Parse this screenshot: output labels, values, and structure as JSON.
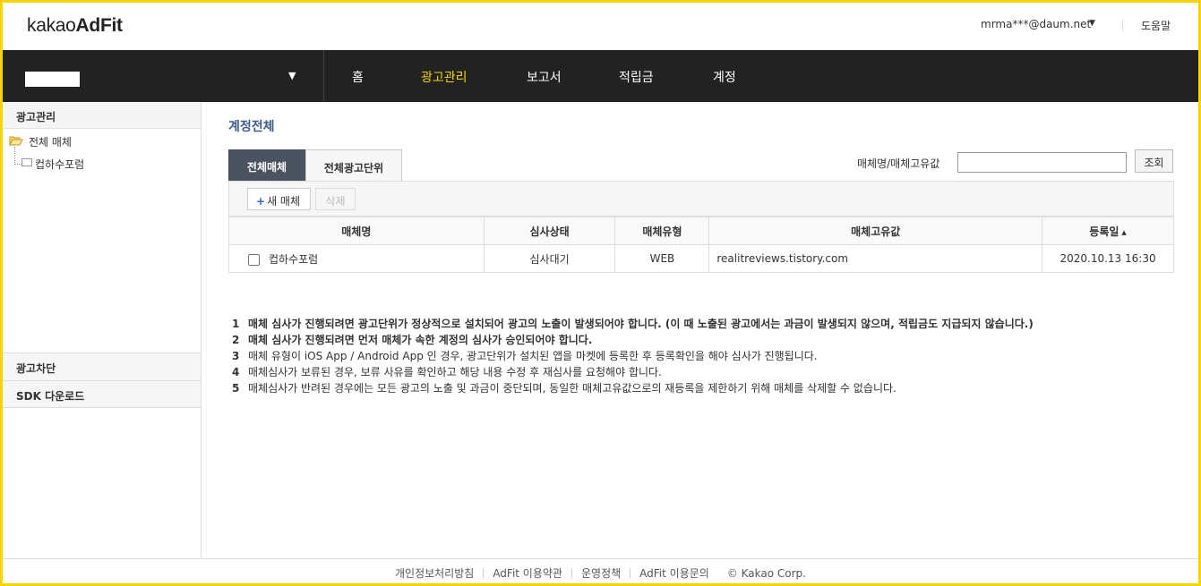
{
  "header": {
    "logo_light": "kakao",
    "logo_bold": "AdFit",
    "user_email": "mrma***@daum.net",
    "help": "도움말"
  },
  "nav": {
    "items": [
      {
        "label": "홈"
      },
      {
        "label": "광고관리"
      },
      {
        "label": "보고서"
      },
      {
        "label": "적립금"
      },
      {
        "label": "계정"
      }
    ],
    "active_index": 1,
    "active_color": "#f5d400"
  },
  "sidebar": {
    "section_title": "광고관리",
    "tree": {
      "root": "전체 매체",
      "children": [
        "컵하수포럼"
      ]
    },
    "menus": [
      "광고차단",
      "SDK 다운로드"
    ]
  },
  "main": {
    "page_title": "계정전체",
    "tabs": [
      {
        "label": "전체매체",
        "active": true
      },
      {
        "label": "전체광고단위",
        "active": false
      }
    ],
    "search": {
      "label": "매체명/매체고유값",
      "value": "",
      "button": "조회"
    },
    "toolbar": {
      "new_button": "새 매체",
      "delete_button": "삭제"
    },
    "table": {
      "columns": [
        "매체명",
        "심사상태",
        "매체유형",
        "매체고유값",
        "등록일"
      ],
      "rows": [
        [
          "컵하수포럼",
          "심사대기",
          "WEB",
          "realitreviews.tistory.com",
          "2020.10.13 16:30"
        ]
      ]
    },
    "notes": [
      {
        "num": "1",
        "text": "매체 심사가 진행되려면 광고단위가 정상적으로 설치되어 광고의 노출이 발생되어야 합니다. (이 때 노출된 광고에서는 과금이 발생되지 않으며, 적립금도 지급되지 않습니다.)",
        "bold": true
      },
      {
        "num": "2",
        "text": "매체 심사가 진행되려면 먼저 매체가 속한 계정의 심사가 승인되어야 합니다.",
        "bold": true
      },
      {
        "num": "3",
        "text": "매체 유형이 iOS App / Android App 인 경우, 광고단위가 설치된 앱을 마켓에 등록한 후 등록확인을 해야 심사가 진행됩니다.",
        "bold": false
      },
      {
        "num": "4",
        "text": "매체심사가 보류된 경우, 보류 사유를 확인하고 해당 내용 수정 후 재심사를 요청해야 합니다.",
        "bold": false
      },
      {
        "num": "5",
        "text": "매체심사가 반려된 경우에는 모든 광고의 노출 및 과금이 중단되며, 동일한 매체고유값으로의 재등록을 제한하기 위해 매체를 삭제할 수 없습니다.",
        "bold": false
      }
    ]
  },
  "footer": {
    "links": [
      "개인정보처리방침",
      "AdFit 이용약관",
      "운영정책",
      "AdFit 이용문의"
    ],
    "copyright": "© Kakao Corp."
  }
}
